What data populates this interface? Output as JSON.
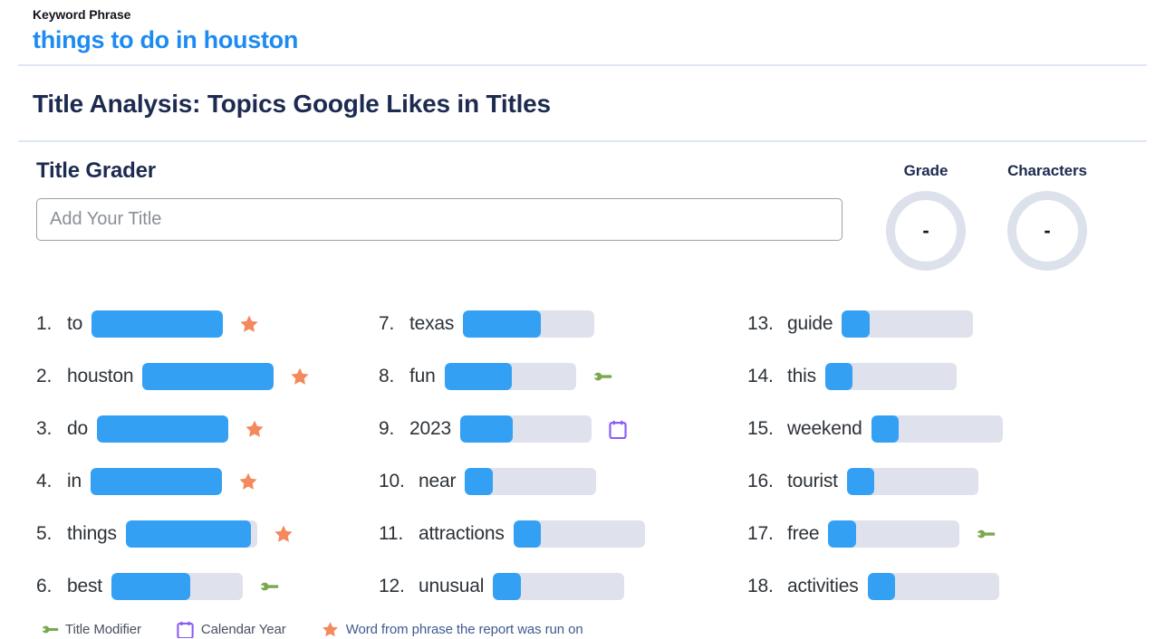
{
  "header": {
    "keyword_label": "Keyword Phrase",
    "keyword_phrase": "things to do in houston",
    "section_title": "Title Analysis: Topics Google Likes in Titles"
  },
  "grader": {
    "title": "Title Grader",
    "input_placeholder": "Add Your Title",
    "input_value": "",
    "gauges": [
      {
        "label": "Grade",
        "value": "-"
      },
      {
        "label": "Characters",
        "value": "-"
      }
    ]
  },
  "colors": {
    "accent_blue": "#34a0f4",
    "track_gray": "#dfe2ec",
    "star_orange": "#f3895c",
    "wrench_green": "#7aa84f",
    "calendar_purple": "#8b5cf6",
    "keyword_blue": "#1d8bf1",
    "navy": "#1d2b50"
  },
  "chart_data": {
    "type": "bar",
    "title": "Title Analysis: Topics Google Likes in Titles",
    "xlabel": "",
    "ylabel": "",
    "xlim": [
      0,
      100
    ],
    "grid": false,
    "legend_position": "bottom",
    "categories": [
      "to",
      "houston",
      "do",
      "in",
      "things",
      "best",
      "texas",
      "fun",
      "2023",
      "near",
      "attractions",
      "unusual",
      "guide",
      "this",
      "weekend",
      "tourist",
      "free",
      "activities"
    ],
    "values": [
      100,
      100,
      100,
      100,
      95,
      60,
      59,
      51,
      40,
      21,
      21,
      21,
      21,
      21,
      21,
      21,
      21,
      21
    ],
    "markers": [
      "star",
      "star",
      "star",
      "star",
      "star",
      "wrench",
      "none",
      "wrench",
      "calendar",
      "none",
      "none",
      "none",
      "none",
      "none",
      "none",
      "none",
      "wrench",
      "none"
    ],
    "legend": [
      {
        "icon": "wrench-icon",
        "label": "Title Modifier"
      },
      {
        "icon": "calendar-icon",
        "label": "Calendar Year"
      },
      {
        "icon": "star-icon",
        "label": "Word from phrase the report was run on"
      }
    ]
  },
  "columns": [
    {
      "rows": [
        {
          "rank": "1.",
          "word": "to",
          "value": 100,
          "marker": "star"
        },
        {
          "rank": "2.",
          "word": "houston",
          "value": 100,
          "marker": "star"
        },
        {
          "rank": "3.",
          "word": "do",
          "value": 100,
          "marker": "star"
        },
        {
          "rank": "4.",
          "word": "in",
          "value": 100,
          "marker": "star"
        },
        {
          "rank": "5.",
          "word": "things",
          "value": 95,
          "marker": "star"
        },
        {
          "rank": "6.",
          "word": "best",
          "value": 60,
          "marker": "wrench"
        }
      ]
    },
    {
      "rows": [
        {
          "rank": "7.",
          "word": "texas",
          "value": 59,
          "marker": "none"
        },
        {
          "rank": "8.",
          "word": "fun",
          "value": 51,
          "marker": "wrench"
        },
        {
          "rank": "9.",
          "word": "2023",
          "value": 40,
          "marker": "calendar"
        },
        {
          "rank": "10.",
          "word": "near",
          "value": 21,
          "marker": "none"
        },
        {
          "rank": "11.",
          "word": "attractions",
          "value": 21,
          "marker": "none"
        },
        {
          "rank": "12.",
          "word": "unusual",
          "value": 21,
          "marker": "none"
        }
      ]
    },
    {
      "rows": [
        {
          "rank": "13.",
          "word": "guide",
          "value": 21,
          "marker": "none"
        },
        {
          "rank": "14.",
          "word": "this",
          "value": 21,
          "marker": "none"
        },
        {
          "rank": "15.",
          "word": "weekend",
          "value": 21,
          "marker": "none"
        },
        {
          "rank": "16.",
          "word": "tourist",
          "value": 21,
          "marker": "none"
        },
        {
          "rank": "17.",
          "word": "free",
          "value": 21,
          "marker": "wrench"
        },
        {
          "rank": "18.",
          "word": "activities",
          "value": 21,
          "marker": "none"
        }
      ]
    }
  ],
  "legend": [
    {
      "icon": "wrench-icon",
      "label": "Title Modifier"
    },
    {
      "icon": "calendar-icon",
      "label": "Calendar Year"
    },
    {
      "icon": "star-icon",
      "label": "Word from phrase the report was run on"
    }
  ]
}
